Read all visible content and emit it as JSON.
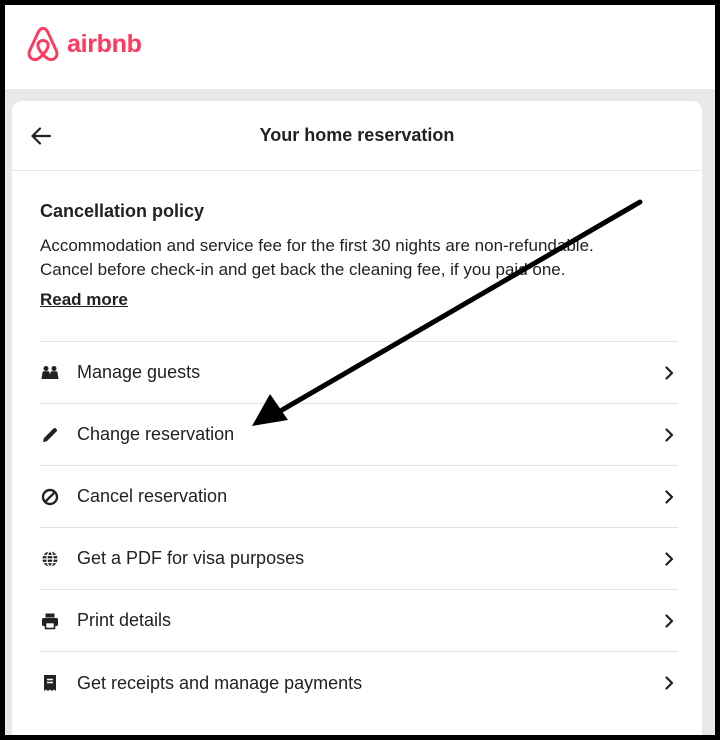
{
  "brand": {
    "name": "airbnb",
    "color": "#FF385C"
  },
  "header": {
    "title": "Your home reservation",
    "back_icon": "arrow-left-icon"
  },
  "policy": {
    "title": "Cancellation policy",
    "line1": "Accommodation and service fee for the first 30 nights are non-refundable.",
    "line2": "Cancel before check-in and get back the cleaning fee, if you paid one.",
    "read_more": "Read more"
  },
  "menu": {
    "items": [
      {
        "label": "Manage guests",
        "icon": "guests-icon"
      },
      {
        "label": "Change reservation",
        "icon": "pencil-icon"
      },
      {
        "label": "Cancel reservation",
        "icon": "cancel-icon"
      },
      {
        "label": "Get a PDF for visa purposes",
        "icon": "globe-icon"
      },
      {
        "label": "Print details",
        "icon": "printer-icon"
      },
      {
        "label": "Get receipts and manage payments",
        "icon": "receipt-icon"
      }
    ]
  },
  "annotation": {
    "pointing_to": "Change reservation"
  }
}
